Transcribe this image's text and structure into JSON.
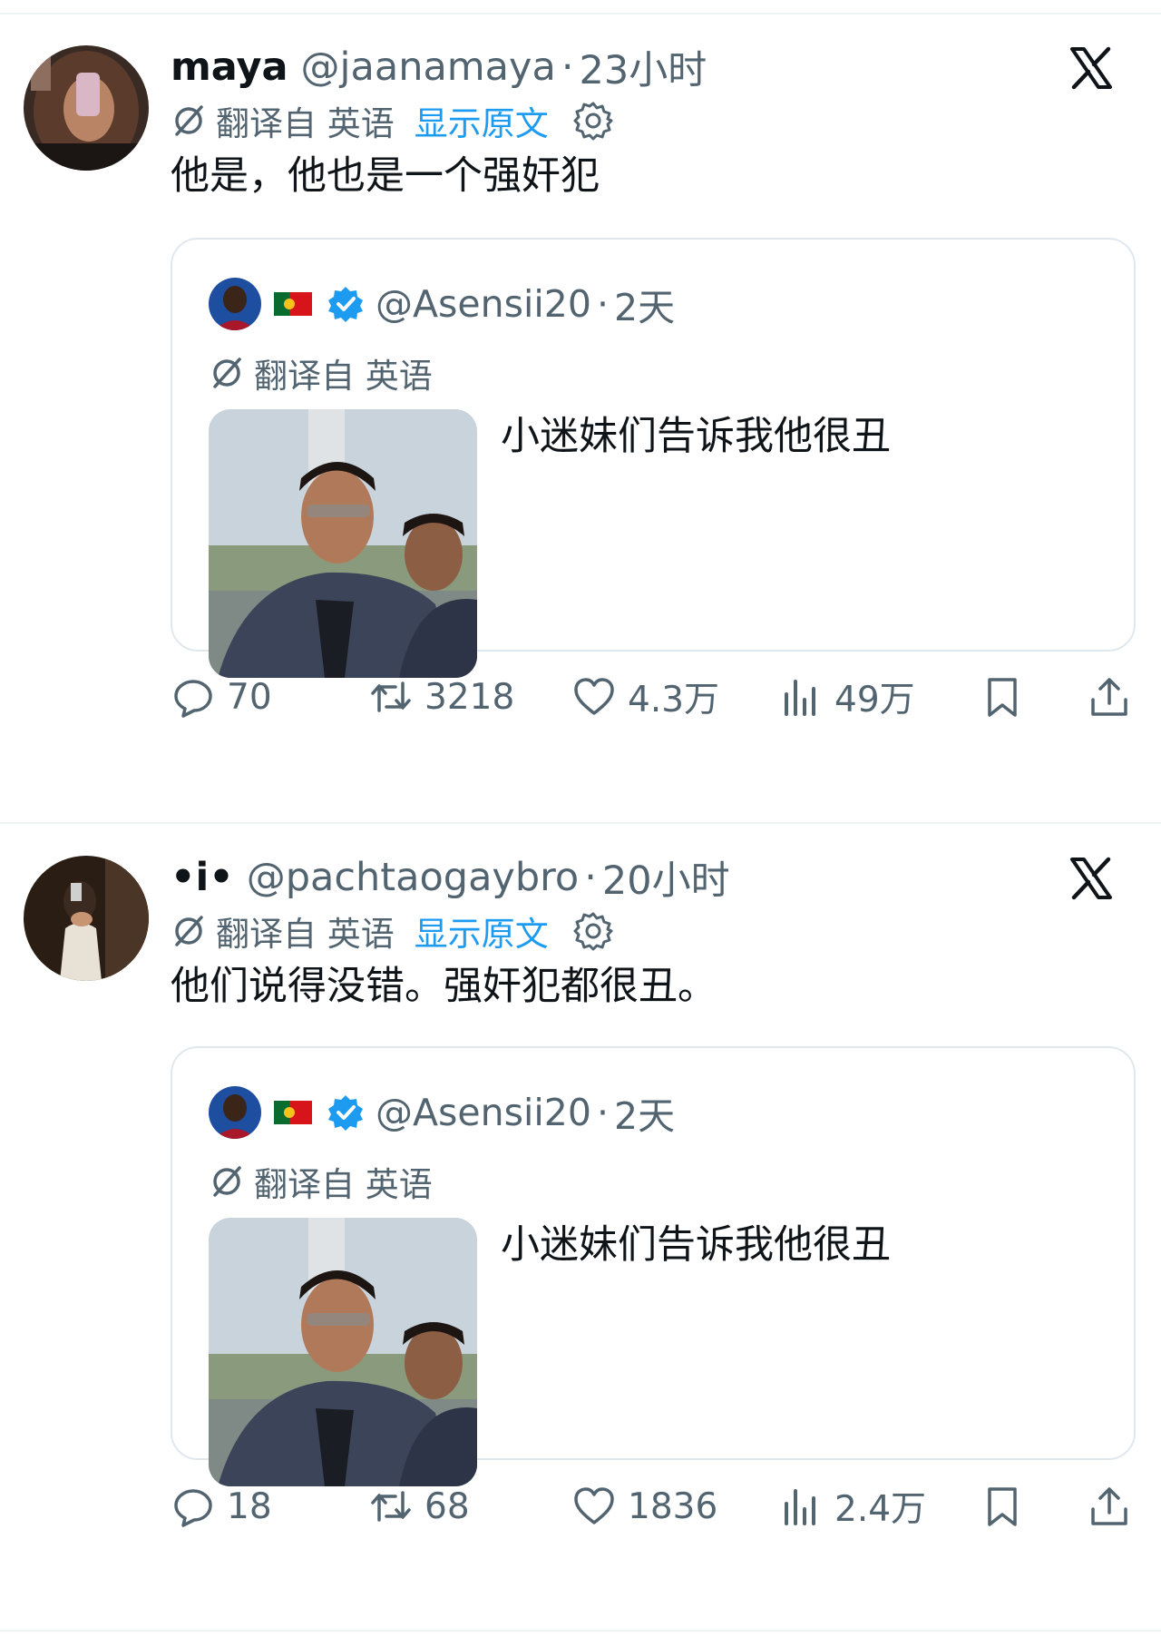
{
  "tweets": [
    {
      "name": "maya",
      "handle": "@jaanamaya",
      "time": "23小时",
      "translated_from": "翻译自 英语",
      "show_original": "显示原文",
      "text": "他是，他也是一个强奸犯",
      "quote": {
        "handle": "@Asensii20",
        "time": "2天",
        "translated_from": "翻译自 英语",
        "text": "小迷妹们告诉我他很丑"
      },
      "stats": {
        "replies": "70",
        "retweets": "3218",
        "likes": "4.3万",
        "views": "49万"
      }
    },
    {
      "name": "•i•",
      "handle": "@pachtaogaybro",
      "time": "20小时",
      "translated_from": "翻译自 英语",
      "show_original": "显示原文",
      "text": "他们说得没错。强奸犯都很丑。",
      "quote": {
        "handle": "@Asensii20",
        "time": "2天",
        "translated_from": "翻译自 英语",
        "text": "小迷妹们告诉我他很丑"
      },
      "stats": {
        "replies": "18",
        "retweets": "68",
        "likes": "1836",
        "views": "2.4万"
      }
    }
  ],
  "colors": {
    "accent": "#1d9bf0",
    "secondary_text": "#536471",
    "border": "#e1e8ed"
  },
  "icons": [
    "x-logo-icon",
    "translate-icon",
    "gear-icon",
    "verified-badge-icon",
    "portugal-flag-icon",
    "reply-icon",
    "retweet-icon",
    "like-icon",
    "views-icon",
    "bookmark-icon",
    "share-icon"
  ]
}
